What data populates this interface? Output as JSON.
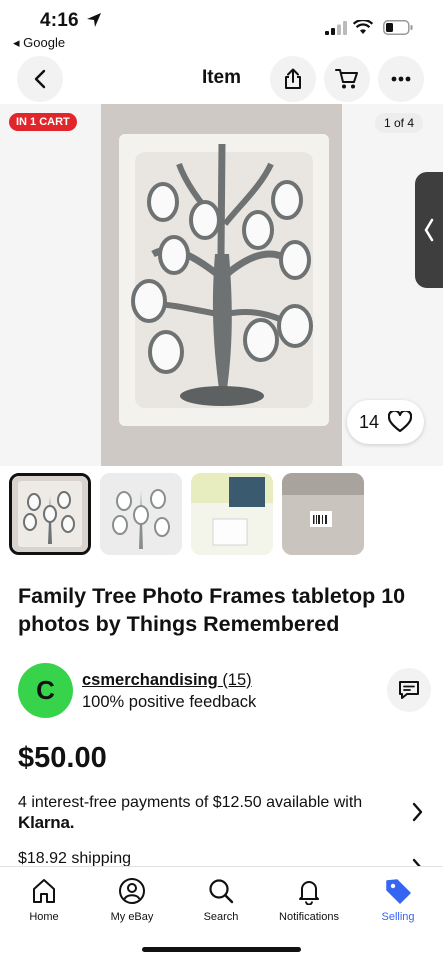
{
  "status": {
    "time": "4:16",
    "back_app": "◂ Google"
  },
  "nav": {
    "title": "Item"
  },
  "hero": {
    "cart_badge": "IN 1 CART",
    "image_counter": "1 of 4",
    "watchers": "14"
  },
  "item": {
    "title": "Family Tree Photo Frames tabletop 10 photos by Things Remembered",
    "price": "$50.00",
    "klarna_text": "4 interest-free payments of $12.50 available with",
    "klarna_brand": "Klarna.",
    "shipping": "$18.92 shipping"
  },
  "seller": {
    "initial": "C",
    "name": "csmerchandising",
    "count": "(15)",
    "feedback": "100% positive feedback"
  },
  "tabs": [
    {
      "label": "Home",
      "icon": "home-icon"
    },
    {
      "label": "My eBay",
      "icon": "user-icon"
    },
    {
      "label": "Search",
      "icon": "search-icon"
    },
    {
      "label": "Notifications",
      "icon": "bell-icon"
    },
    {
      "label": "Selling",
      "icon": "tag-icon"
    }
  ],
  "colors": {
    "accent": "#3665f3",
    "badge_red": "#e0252b",
    "avatar_green": "#37d34b"
  }
}
